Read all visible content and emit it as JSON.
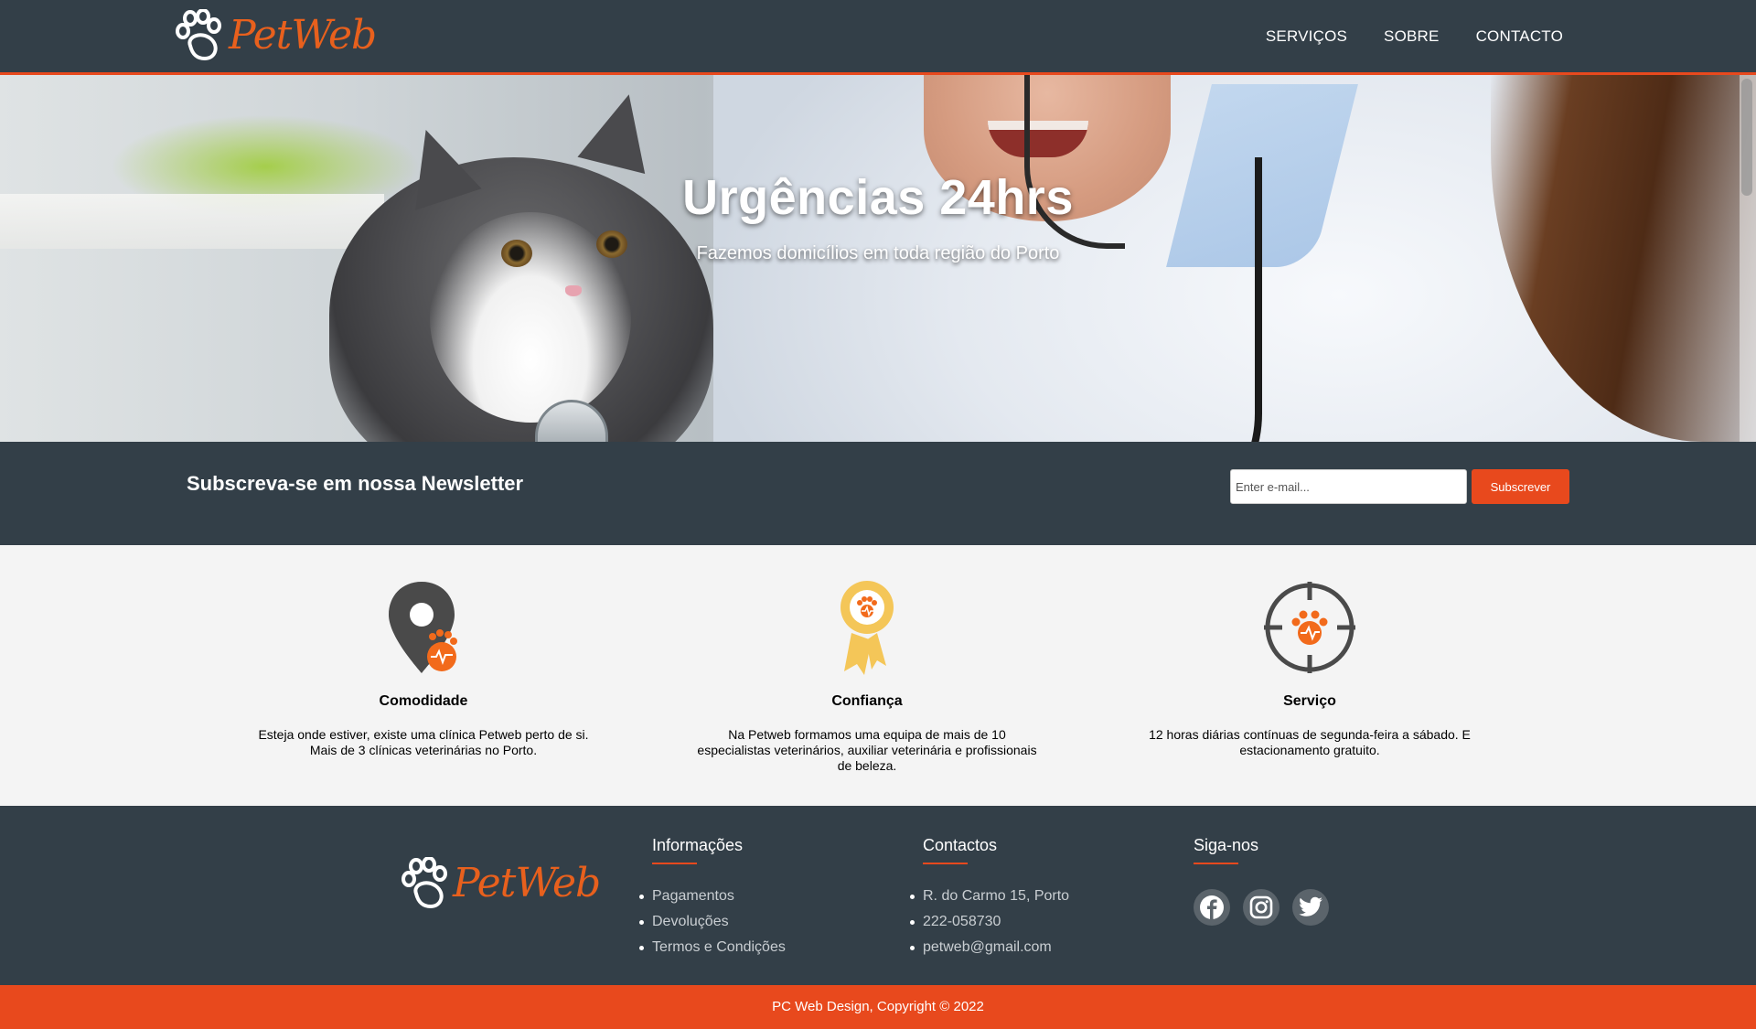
{
  "header": {
    "logo_text": "PetWeb",
    "nav": [
      "SERVIÇOS",
      "SOBRE",
      "CONTACTO"
    ]
  },
  "hero": {
    "title": "Urgências 24hrs",
    "subtitle": "Fazemos domicílios em toda região do Porto"
  },
  "newsletter": {
    "heading": "Subscreva-se em nossa Newsletter",
    "placeholder": "Enter e-mail...",
    "button_label": "Subscrever"
  },
  "features": [
    {
      "icon": "location-pin-paw-icon",
      "title": "Comodidade",
      "text": "Esteja onde estiver, existe uma clínica Petweb perto de si. Mais de 3 clínicas veterinárias no Porto."
    },
    {
      "icon": "award-ribbon-paw-icon",
      "title": "Confiança",
      "text": "Na Petweb formamos uma equipa de mais de 10 especialistas veterinários, auxiliar veterinária e profissionais de beleza."
    },
    {
      "icon": "crosshair-paw-icon",
      "title": "Serviço",
      "text": "12 horas diárias contínuas de segunda-feira a sábado. E estacionamento gratuito."
    }
  ],
  "footer": {
    "logo_text": "PetWeb",
    "info": {
      "title": "Informações",
      "items": [
        "Pagamentos",
        "Devoluções",
        "Termos e Condições"
      ]
    },
    "contacts": {
      "title": "Contactos",
      "items": [
        "R. do Carmo 15, Porto",
        "222-058730",
        "petweb@gmail.com"
      ]
    },
    "social": {
      "title": "Siga-nos",
      "icons": [
        "facebook-icon",
        "instagram-icon",
        "twitter-icon"
      ]
    }
  },
  "copyright": "PC Web Design, Copyright © 2022",
  "colors": {
    "dark": "#333f48",
    "accent": "#e8491d",
    "background": "#f4f4f4"
  }
}
